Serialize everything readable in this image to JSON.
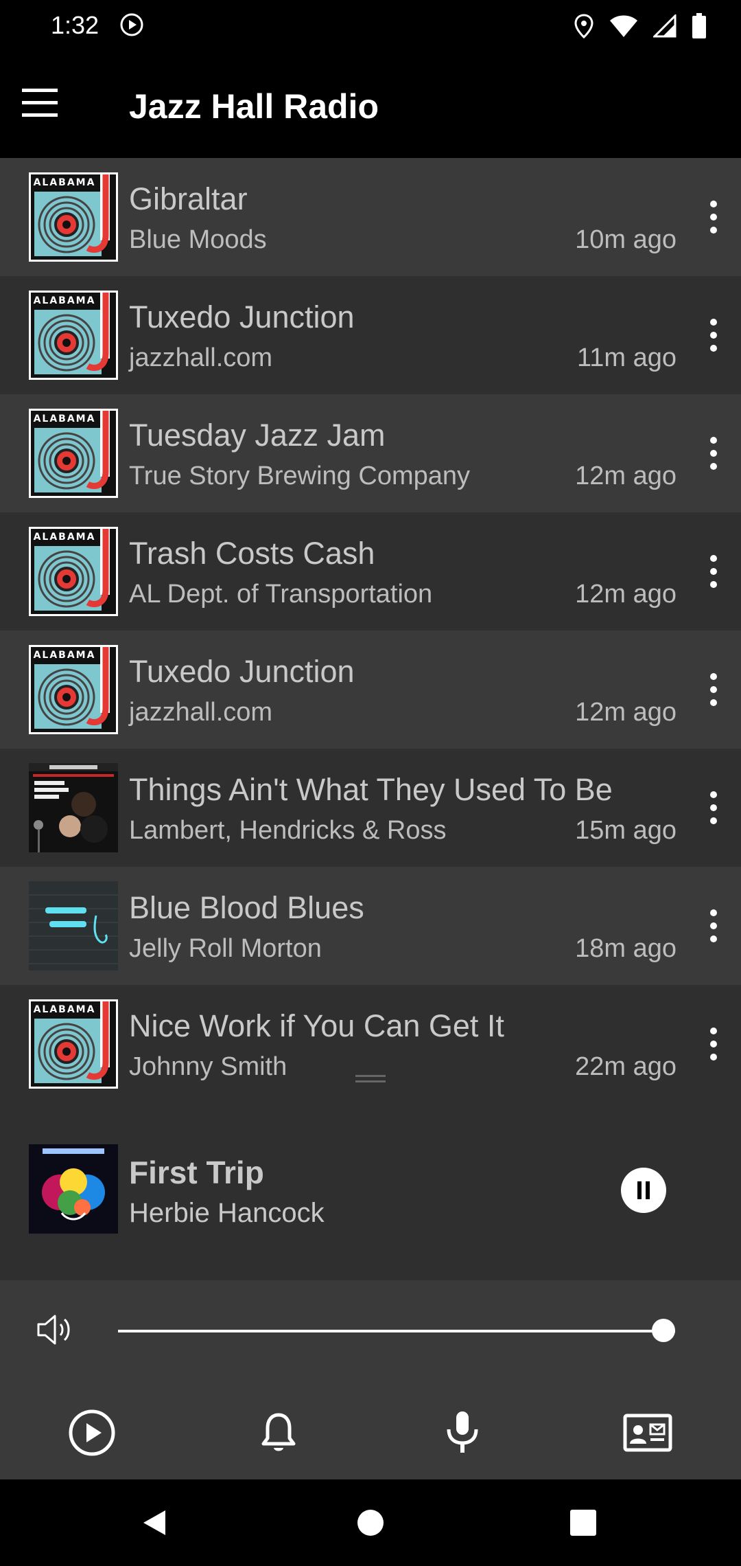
{
  "status_bar": {
    "time": "1:32"
  },
  "app_bar": {
    "title": "Jazz Hall Radio"
  },
  "tracks": [
    {
      "title": "Gibraltar",
      "artist": "Blue Moods",
      "time": "10m ago",
      "art": "alabama-jazz-logo"
    },
    {
      "title": "Tuxedo Junction",
      "artist": "jazzhall.com",
      "time": "11m ago",
      "art": "alabama-jazz-logo"
    },
    {
      "title": "Tuesday Jazz Jam",
      "artist": "True Story Brewing Company",
      "time": "12m ago",
      "art": "alabama-jazz-logo"
    },
    {
      "title": "Trash Costs Cash",
      "artist": "AL Dept. of Transportation",
      "time": "12m ago",
      "art": "alabama-jazz-logo"
    },
    {
      "title": "Tuxedo Junction",
      "artist": "jazzhall.com",
      "time": "12m ago",
      "art": "alabama-jazz-logo"
    },
    {
      "title": "Things Ain't What They Used To Be",
      "artist": "Lambert, Hendricks & Ross",
      "time": "15m ago",
      "art": "lambert-hendricks-ross-cover"
    },
    {
      "title": "Blue Blood Blues",
      "artist": "Jelly Roll Morton",
      "time": "18m ago",
      "art": "jelly-roll-morton-cover"
    },
    {
      "title": "Nice Work if You Can Get It",
      "artist": "Johnny Smith",
      "time": "22m ago",
      "art": "alabama-jazz-logo"
    }
  ],
  "logo_text": "ALABAMA",
  "now_playing": {
    "title": "First Trip",
    "artist": "Herbie Hancock",
    "art": "herbie-hancock-cover",
    "state": "playing"
  },
  "volume": {
    "level": 1.0
  },
  "bottom_nav": [
    {
      "name": "play",
      "icon": "play-circle-icon"
    },
    {
      "name": "alerts",
      "icon": "bell-icon"
    },
    {
      "name": "voice",
      "icon": "microphone-icon"
    },
    {
      "name": "contact",
      "icon": "contact-card-icon"
    }
  ],
  "colors": {
    "row_light": "#3a3a3a",
    "row_dark": "#2f2f2f",
    "logo_red": "#e53935",
    "logo_teal": "#7fc7cf"
  }
}
